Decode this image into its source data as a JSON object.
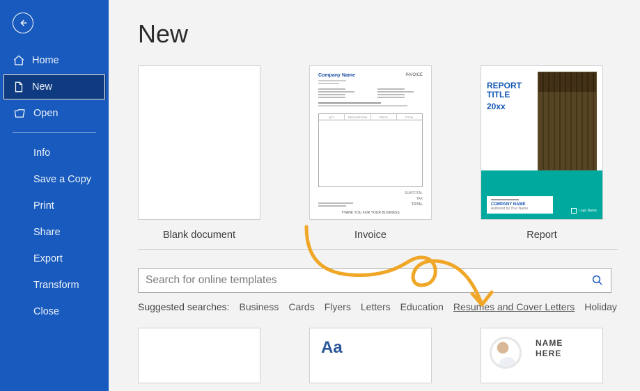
{
  "sidebar": {
    "back_label": "Back",
    "primary": [
      {
        "icon": "home-icon",
        "label": "Home"
      },
      {
        "icon": "document-icon",
        "label": "New"
      },
      {
        "icon": "folder-open-icon",
        "label": "Open"
      }
    ],
    "secondary": [
      "Info",
      "Save a Copy",
      "Print",
      "Share",
      "Export",
      "Transform",
      "Close"
    ],
    "selected": "New"
  },
  "main": {
    "title": "New",
    "templates": [
      {
        "name": "Blank document"
      },
      {
        "name": "Invoice",
        "preview": {
          "company": "Company Name",
          "invoice_label": "INVOICE"
        }
      },
      {
        "name": "Report",
        "preview": {
          "title_line1": "REPORT TITLE",
          "title_line2": "20xx",
          "company": "COMPANY NAME",
          "author": "Authored by Your Name",
          "logo": "Logo Name"
        }
      }
    ],
    "search": {
      "placeholder": "Search for online templates"
    },
    "suggest_label": "Suggested searches:",
    "suggest_links": [
      "Business",
      "Cards",
      "Flyers",
      "Letters",
      "Education",
      "Resumes and Cover Letters",
      "Holiday"
    ],
    "suggest_underlined": "Resumes and Cover Letters",
    "bottom_previews": {
      "font_sample": "Aa",
      "resume_name_line1": "NAME",
      "resume_name_line2": "HERE"
    }
  },
  "colors": {
    "accent": "#185abd",
    "teal": "#00a99d",
    "arrow": "#f0a626"
  }
}
